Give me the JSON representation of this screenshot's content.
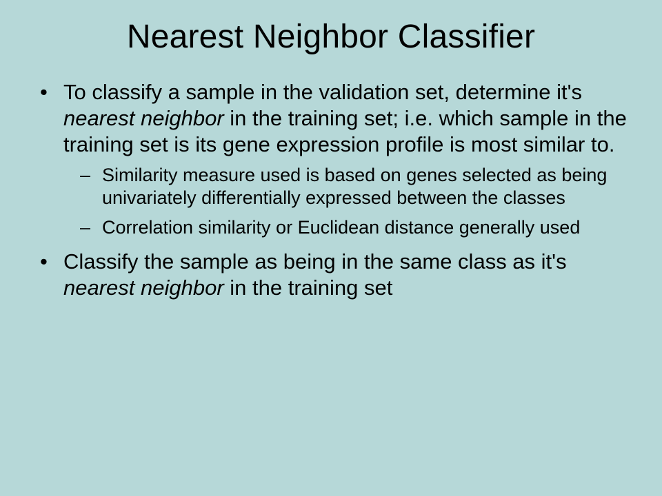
{
  "title": "Nearest Neighbor Classifier",
  "bullets": [
    {
      "pre": "To classify a sample in the validation set, determine it's ",
      "em": "nearest neighbor",
      "post": " in the training set; i.e. which sample in the training set is its gene expression profile is most similar to.",
      "sub": [
        "Similarity measure used is based on genes selected as being univariately differentially expressed between the classes",
        "Correlation similarity or Euclidean distance generally used"
      ]
    },
    {
      "pre": "Classify the sample as being in the same class as it's ",
      "em": "nearest neighbor",
      "post": " in the training set",
      "sub": []
    }
  ]
}
